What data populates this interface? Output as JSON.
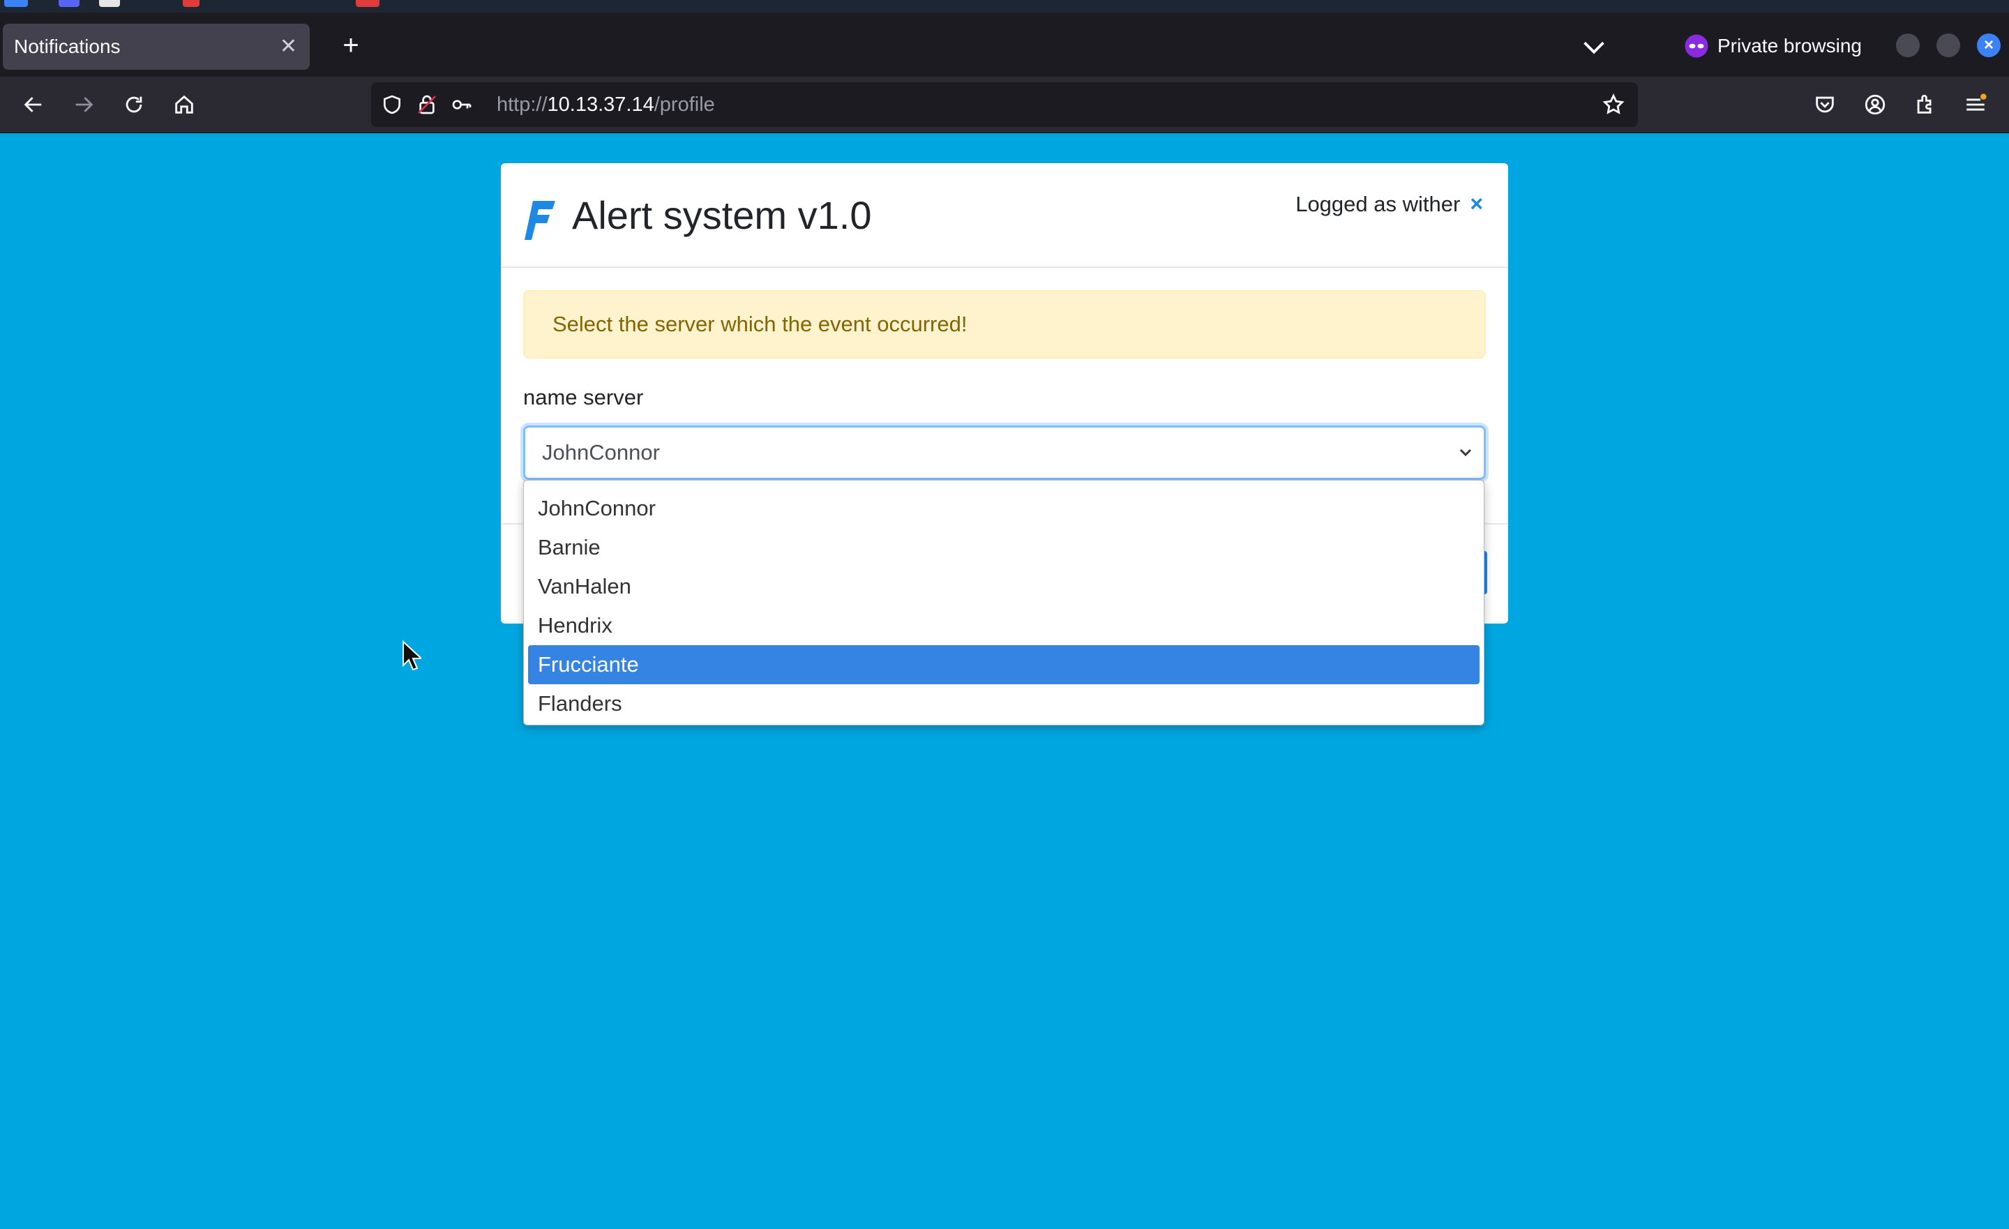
{
  "browser": {
    "tab": {
      "title": "Notifications",
      "close_glyph": "✕"
    },
    "new_tab_glyph": "+",
    "private_label": "Private browsing",
    "url": {
      "scheme": "http://",
      "host": "10.13.37.14",
      "path": "/profile"
    },
    "icons": [
      "back-icon",
      "forward-icon",
      "reload-icon",
      "home-icon",
      "shield-icon",
      "lock-icon",
      "key-icon",
      "star-icon",
      "pocket-icon",
      "account-icon",
      "extensions-icon",
      "menu-icon"
    ]
  },
  "app": {
    "title": "Alert system v1.0",
    "logged_as": "Logged as wither",
    "logout_glyph": "×",
    "alert_message": "Select the server which the event occurred!",
    "field_label": "name server",
    "selected_value": "JohnConnor",
    "options": [
      {
        "label": "JohnConnor",
        "highlighted": false
      },
      {
        "label": "Barnie",
        "highlighted": false
      },
      {
        "label": "VanHalen",
        "highlighted": false
      },
      {
        "label": "Hendrix",
        "highlighted": false
      },
      {
        "label": "Frucciante",
        "highlighted": true
      },
      {
        "label": "Flanders",
        "highlighted": false
      }
    ]
  },
  "colors": {
    "page_background": "#00a6e0",
    "alert_background": "#fff3cd",
    "alert_text": "#856404",
    "highlight": "#3584e4",
    "accent": "#1e88e5"
  }
}
